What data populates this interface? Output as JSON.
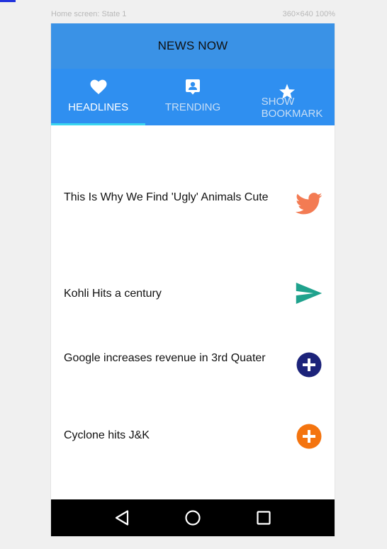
{
  "canvas": {
    "label": "Home screen: State 1",
    "meta": "360×640  100%"
  },
  "app": {
    "title": "NEWS NOW"
  },
  "tabs": [
    {
      "label": "HEADLINES",
      "icon": "heart-icon",
      "active": true
    },
    {
      "label": "TRENDING",
      "icon": "person-badge-icon",
      "active": false
    },
    {
      "label": "SHOW\nBOOKMARK",
      "icon": "star-icon",
      "active": false
    }
  ],
  "news": [
    {
      "title": "This Is Why We Find 'Ugly' Animals Cute",
      "action_icon": "twitter-bird-icon",
      "color": "#f37b53"
    },
    {
      "title": "Kohli Hits a century",
      "action_icon": "send-icon",
      "color": "#1fa28d"
    },
    {
      "title": "Google increases revenue in 3rd Quater",
      "action_icon": "add-circle-icon",
      "color": "#1c237a"
    },
    {
      "title": "Cyclone hits J&K",
      "action_icon": "add-circle-icon",
      "color": "#f4740f"
    }
  ],
  "navbar": {
    "buttons": [
      "back-icon",
      "home-icon",
      "recents-icon"
    ]
  },
  "colors": {
    "appbar": "#3a92e6",
    "tabbar": "#2f8ff0",
    "indicator": "#3ad6ef"
  }
}
